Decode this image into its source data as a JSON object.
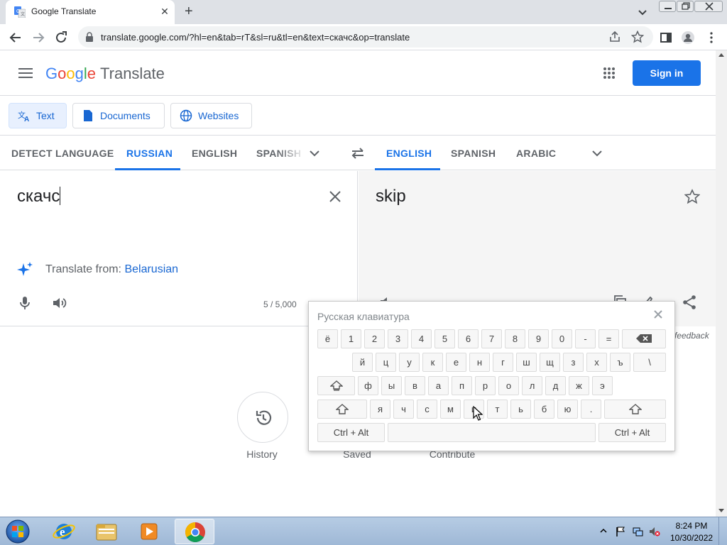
{
  "browser": {
    "tab_title": "Google Translate",
    "tab_close": "✕",
    "new_tab": "+",
    "url": "translate.google.com/?hl=en&tab=rT&sl=ru&tl=en&text=скачс&op=translate"
  },
  "header": {
    "logo_G": "G",
    "logo_o1": "o",
    "logo_o2": "o",
    "logo_g": "g",
    "logo_l": "l",
    "logo_e": "e",
    "product": "Translate",
    "signin_label": "Sign in"
  },
  "modes": {
    "text": "Text",
    "documents": "Documents",
    "websites": "Websites"
  },
  "source_langs": [
    "DETECT LANGUAGE",
    "RUSSIAN",
    "ENGLISH",
    "SPANISH"
  ],
  "target_langs": [
    "ENGLISH",
    "SPANISH",
    "ARABIC"
  ],
  "source": {
    "text": "скачс",
    "translate_from_prefix": "Translate from: ",
    "translate_from_lang": "Belarusian",
    "char_count": "5 / 5,000"
  },
  "target": {
    "text": "skip",
    "feedback": "feedback"
  },
  "bottom": {
    "history": "History",
    "saved": "Saved",
    "contribute": "Contribute"
  },
  "keyboard": {
    "title": "Русская клавиатура",
    "row1": [
      "ё",
      "1",
      "2",
      "3",
      "4",
      "5",
      "6",
      "7",
      "8",
      "9",
      "0",
      "-",
      "="
    ],
    "row2": [
      "й",
      "ц",
      "у",
      "к",
      "е",
      "н",
      "г",
      "ш",
      "щ",
      "з",
      "х",
      "ъ",
      "\\"
    ],
    "row3": [
      "ф",
      "ы",
      "в",
      "а",
      "п",
      "р",
      "о",
      "л",
      "д",
      "ж",
      "э"
    ],
    "row4": [
      "я",
      "ч",
      "с",
      "м",
      "и",
      "т",
      "ь",
      "б",
      "ю",
      "."
    ],
    "ctrl_alt": "Ctrl + Alt"
  },
  "taskbar": {
    "time": "8:24 PM",
    "date": "10/30/2022"
  },
  "colors": {
    "accent": "#1a73e8",
    "signin_bg": "#1a73e8",
    "target_panel_bg": "#f5f5f5"
  },
  "icons": {
    "back": "arrow-left-icon",
    "forward": "arrow-right-icon",
    "reload": "reload-icon",
    "share": "share-icon",
    "bookmark": "star-icon",
    "apps": "apps-grid-icon",
    "mic": "mic-icon",
    "speaker": "speaker-icon",
    "clear": "close-icon",
    "swap": "swap-icon",
    "history": "history-icon",
    "backspace": "backspace-icon",
    "shift": "shift-icon"
  }
}
